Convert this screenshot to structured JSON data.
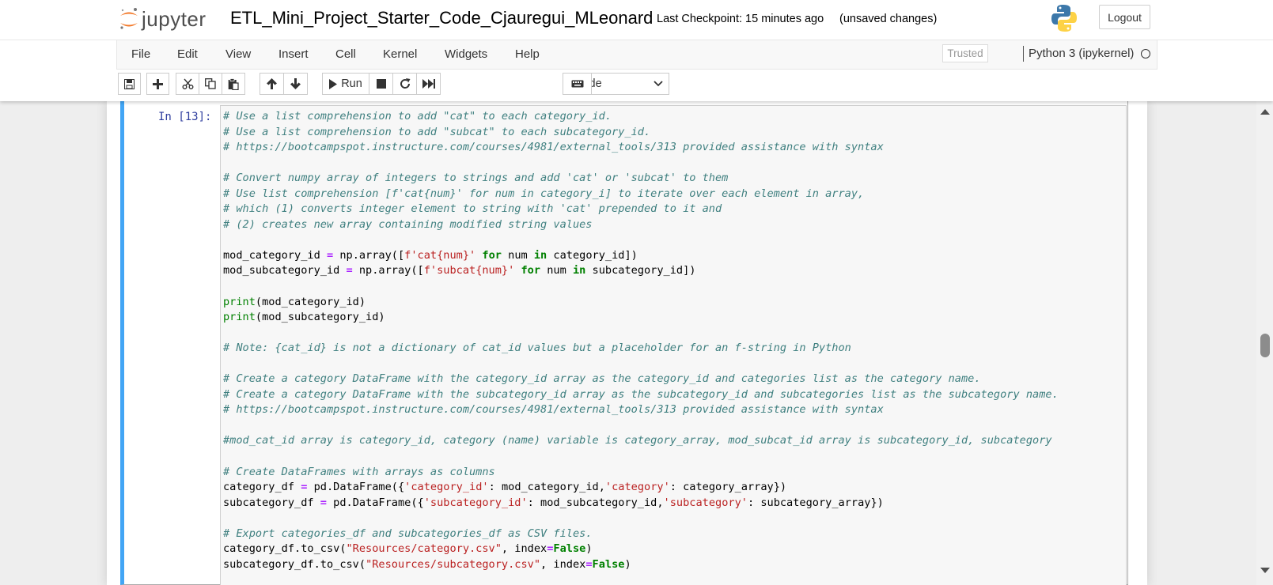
{
  "header": {
    "logo_text": "jupyter",
    "notebook_name": "ETL_Mini_Project_Starter_Code_Cjauregui_MLeonard",
    "checkpoint": "Last Checkpoint: 15 minutes ago",
    "unsaved": "(unsaved changes)",
    "logout_label": "Logout"
  },
  "menu": {
    "items": [
      "File",
      "Edit",
      "View",
      "Insert",
      "Cell",
      "Kernel",
      "Widgets",
      "Help"
    ],
    "trusted_label": "Trusted",
    "kernel_name": "Python 3 (ipykernel)"
  },
  "toolbar": {
    "run_label": "Run",
    "cell_type": "Code",
    "icons": [
      "save-icon",
      "plus-icon",
      "cut-icon",
      "copy-icon",
      "paste-icon",
      "arrow-up-icon",
      "arrow-down-icon",
      "run-icon",
      "stop-icon",
      "restart-icon",
      "fast-forward-icon",
      "keyboard-icon"
    ]
  },
  "cell": {
    "prompt": "In [13]:",
    "lines": [
      "# Use a list comprehension to add \"cat\" to each category_id.",
      "# Use a list comprehension to add \"subcat\" to each subcategory_id.",
      "# https://bootcampspot.instructure.com/courses/4981/external_tools/313 provided assistance with syntax",
      "",
      "# Convert numpy array of integers to strings and add 'cat' or 'subcat' to them",
      "# Use list comprehension [f'cat{num}' for num in category_i] to iterate over each element in array,",
      "# which (1) converts integer element to string with 'cat' prepended to it and",
      "# (2) creates new array containing modified string values",
      "",
      "mod_category_id = np.array([f'cat{num}' for num in category_id])",
      "mod_subcategory_id = np.array([f'subcat{num}' for num in subcategory_id])",
      "",
      "print(mod_category_id)",
      "print(mod_subcategory_id)",
      "",
      "# Note: {cat_id} is not a dictionary of cat_id values but a placeholder for an f-string in Python",
      "",
      "# Create a category DataFrame with the category_id array as the category_id and categories list as the category name.",
      "# Create a category DataFrame with the subcategory_id array as the subcategory_id and subcategories list as the subcategory name.",
      "# https://bootcampspot.instructure.com/courses/4981/external_tools/313 provided assistance with syntax",
      "",
      "#mod_cat_id array is category_id, category (name) variable is category_array, mod_subcat_id array is subcategory_id, subcategory",
      "",
      "# Create DataFrames with arrays as columns",
      "category_df = pd.DataFrame({'category_id': mod_category_id,'category': category_array})",
      "subcategory_df = pd.DataFrame({'subcategory_id': mod_subcategory_id,'subcategory': subcategory_array})",
      "",
      "# Export categories_df and subcategories_df as CSV files.",
      "category_df.to_csv(\"Resources/category.csv\", index=False)",
      "subcategory_df.to_csv(\"Resources/subcategory.csv\", index=False)"
    ]
  },
  "colors": {
    "cell_selected_border": "#42a5f5",
    "prompt_in": "#303f9f",
    "comment": "#408080",
    "string": "#ba2121",
    "keyword": "#008000",
    "operator": "#aa22ff"
  }
}
